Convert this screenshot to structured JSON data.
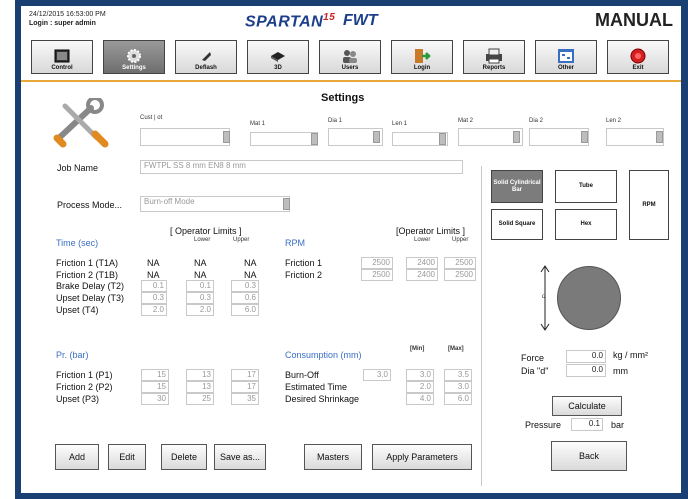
{
  "header": {
    "datetime": "24/12/2015  16:53:00 PM",
    "login": "Login : super admin",
    "brand": "SPARTAN",
    "brand_suffix": "15",
    "brand_sub": "FWT",
    "mode": "MANUAL"
  },
  "toolbar": [
    {
      "label": "Control",
      "icon": "control-icon"
    },
    {
      "label": "Settings",
      "icon": "gear-icon"
    },
    {
      "label": "Deflash",
      "icon": "deflash-icon"
    },
    {
      "label": "3D",
      "icon": "3d-icon"
    },
    {
      "label": "Users",
      "icon": "users-icon"
    },
    {
      "label": "Login",
      "icon": "login-icon"
    },
    {
      "label": "Reports",
      "icon": "reports-icon"
    },
    {
      "label": "Other",
      "icon": "other-icon"
    },
    {
      "label": "Exit",
      "icon": "exit-icon"
    }
  ],
  "page_title": "Settings",
  "spec_fields": {
    "cust_id": "Cust | ot",
    "mat1": "Mat 1",
    "dia1": "Dia 1",
    "len1": "Len 1",
    "mat2": "Mat 2",
    "dia2": "Dia 2",
    "len2": "Len 2"
  },
  "job": {
    "label": "Job Name",
    "value": "FWTPL SS 8 mm EN8 8 mm"
  },
  "process": {
    "label": "Process Mode...",
    "value": "Burn-off Mode"
  },
  "time": {
    "title": "Time (sec)",
    "limits": "[ Operator Limits ]",
    "lower": "Lower",
    "upper": "Upper",
    "rows": [
      {
        "label": "Friction 1 (T1A)",
        "v": "NA",
        "lo": "NA",
        "hi": "NA",
        "plain": true
      },
      {
        "label": "Friction 2 (T1B)",
        "v": "NA",
        "lo": "NA",
        "hi": "NA",
        "plain": true
      },
      {
        "label": "Brake Delay (T2)",
        "v": "0.1",
        "lo": "0.1",
        "hi": "0.3"
      },
      {
        "label": "Upset Delay (T3)",
        "v": "0.3",
        "lo": "0.3",
        "hi": "0.6"
      },
      {
        "label": "Upset (T4)",
        "v": "2.0",
        "lo": "2.0",
        "hi": "6.0"
      }
    ]
  },
  "rpm": {
    "title": "RPM",
    "limits": "[Operator Limits ]",
    "lower": "Lower",
    "upper": "Upper",
    "rows": [
      {
        "label": "Friction 1",
        "v": "2500",
        "lo": "2400",
        "hi": "2500"
      },
      {
        "label": "Friction 2",
        "v": "2500",
        "lo": "2400",
        "hi": "2500"
      }
    ]
  },
  "pressure": {
    "title": "Pr. (bar)",
    "rows": [
      {
        "label": "Friction 1 (P1)",
        "v": "15",
        "lo": "13",
        "hi": "17"
      },
      {
        "label": "Friction 2 (P2)",
        "v": "15",
        "lo": "13",
        "hi": "17"
      },
      {
        "label": "Upset (P3)",
        "v": "30",
        "lo": "25",
        "hi": "35"
      }
    ]
  },
  "consumption": {
    "title": "Consumption (mm)",
    "min": "[Min]",
    "max": "[Max]",
    "rows": [
      {
        "label": "Burn-Off",
        "v": "3.0",
        "lo": "3.0",
        "hi": "3.5"
      },
      {
        "label": "Estimated Time",
        "v": "",
        "lo": "2.0",
        "hi": "3.0"
      },
      {
        "label": "Desired Shrinkage",
        "v": "",
        "lo": "4.0",
        "hi": "6.0"
      }
    ]
  },
  "shapes": {
    "solid_cyl": "Solid Cylindrical Bar",
    "tube": "Tube",
    "rpm": "RPM",
    "solid_sq": "Solid Square",
    "hex": "Hex",
    "dim_d": "d"
  },
  "calc": {
    "force_label": "Force",
    "force_value": "0.0",
    "force_unit": "kg / mm²",
    "dia_label": "Dia \"d\"",
    "dia_value": "0.0",
    "dia_unit": "mm",
    "calculate": "Calculate",
    "pressure_label": "Pressure",
    "pressure_value": "0.1",
    "pressure_unit": "bar",
    "back": "Back"
  },
  "buttons": {
    "add": "Add",
    "edit": "Edit",
    "delete": "Delete",
    "save_as": "Save as...",
    "masters": "Masters",
    "apply": "Apply Parameters"
  }
}
